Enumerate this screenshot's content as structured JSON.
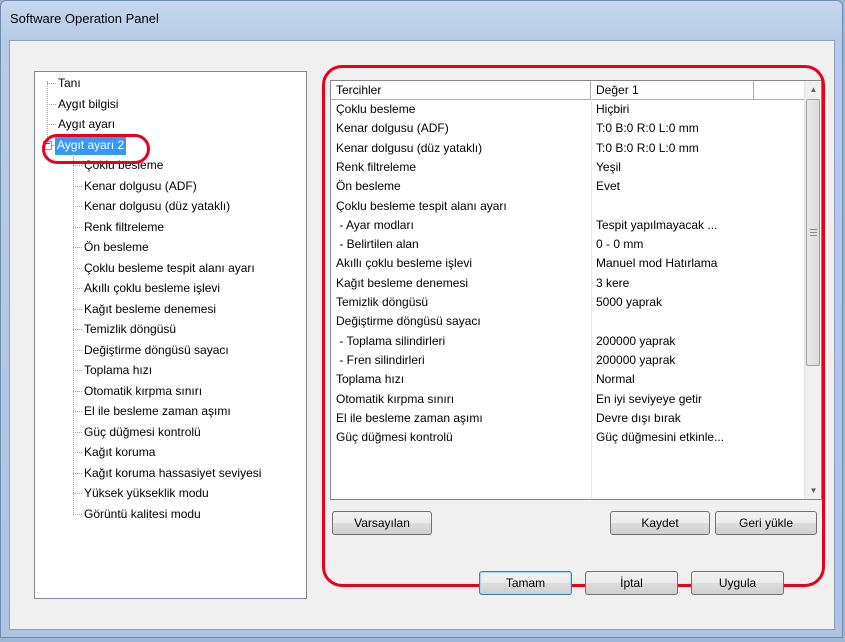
{
  "window": {
    "title": "Software Operation Panel"
  },
  "tree": {
    "root_items": [
      "Tanı",
      "Aygıt bilgisi",
      "Aygıt ayarı",
      "Aygıt ayarı 2"
    ],
    "expander_symbol": "−",
    "children": [
      "Çoklu besleme",
      "Kenar dolgusu (ADF)",
      "Kenar dolgusu (düz yataklı)",
      "Renk filtreleme",
      "Ön besleme",
      "Çoklu besleme tespit alanı ayarı",
      "Akıllı çoklu besleme işlevi",
      "Kağıt besleme denemesi",
      "Temizlik döngüsü",
      "Değiştirme döngüsü sayacı",
      "Toplama hızı",
      "Otomatik kırpma sınırı",
      "El ile besleme zaman aşımı",
      "Güç düğmesi kontrolü",
      "Kağıt koruma",
      "Kağıt koruma hassasiyet seviyesi",
      "Yüksek yükseklik modu",
      "Görüntü kalitesi modu"
    ]
  },
  "grid": {
    "headers": [
      "Tercihler",
      "Değer 1"
    ],
    "rows": [
      [
        "Çoklu besleme",
        "Hiçbiri"
      ],
      [
        "Kenar dolgusu (ADF)",
        "T:0 B:0 R:0 L:0 mm"
      ],
      [
        "Kenar dolgusu (düz yataklı)",
        "T:0 B:0 R:0 L:0 mm"
      ],
      [
        "Renk filtreleme",
        "Yeşil"
      ],
      [
        "Ön besleme",
        "Evet"
      ],
      [
        "Çoklu besleme tespit alanı ayarı",
        ""
      ],
      [
        " - Ayar modları",
        "Tespit yapılmayacak ..."
      ],
      [
        " - Belirtilen alan",
        "0 - 0 mm"
      ],
      [
        "Akıllı çoklu besleme işlevi",
        "Manuel mod  Hatırlama"
      ],
      [
        "Kağıt besleme denemesi",
        "3 kere"
      ],
      [
        "Temizlik döngüsü",
        "5000 yaprak"
      ],
      [
        "Değiştirme döngüsü sayacı",
        ""
      ],
      [
        " - Toplama silindirleri",
        "200000 yaprak"
      ],
      [
        " - Fren silindirleri",
        "200000 yaprak"
      ],
      [
        "Toplama hızı",
        "Normal"
      ],
      [
        "Otomatik kırpma sınırı",
        "En iyi seviyeye getir"
      ],
      [
        "El ile besleme zaman aşımı",
        "Devre dışı bırak"
      ],
      [
        "Güç düğmesi kontrolü",
        "Güç düğmesini etkinle..."
      ]
    ],
    "scroll_up_glyph": "▲",
    "scroll_down_glyph": "▼"
  },
  "panel_buttons": {
    "defaults": "Varsayılan",
    "save": "Kaydet",
    "restore": "Geri yükle"
  },
  "dialog_buttons": {
    "ok": "Tamam",
    "cancel": "İptal",
    "apply": "Uygula"
  },
  "highlight_color": "#e8001c",
  "selection_color": "#3399ff"
}
